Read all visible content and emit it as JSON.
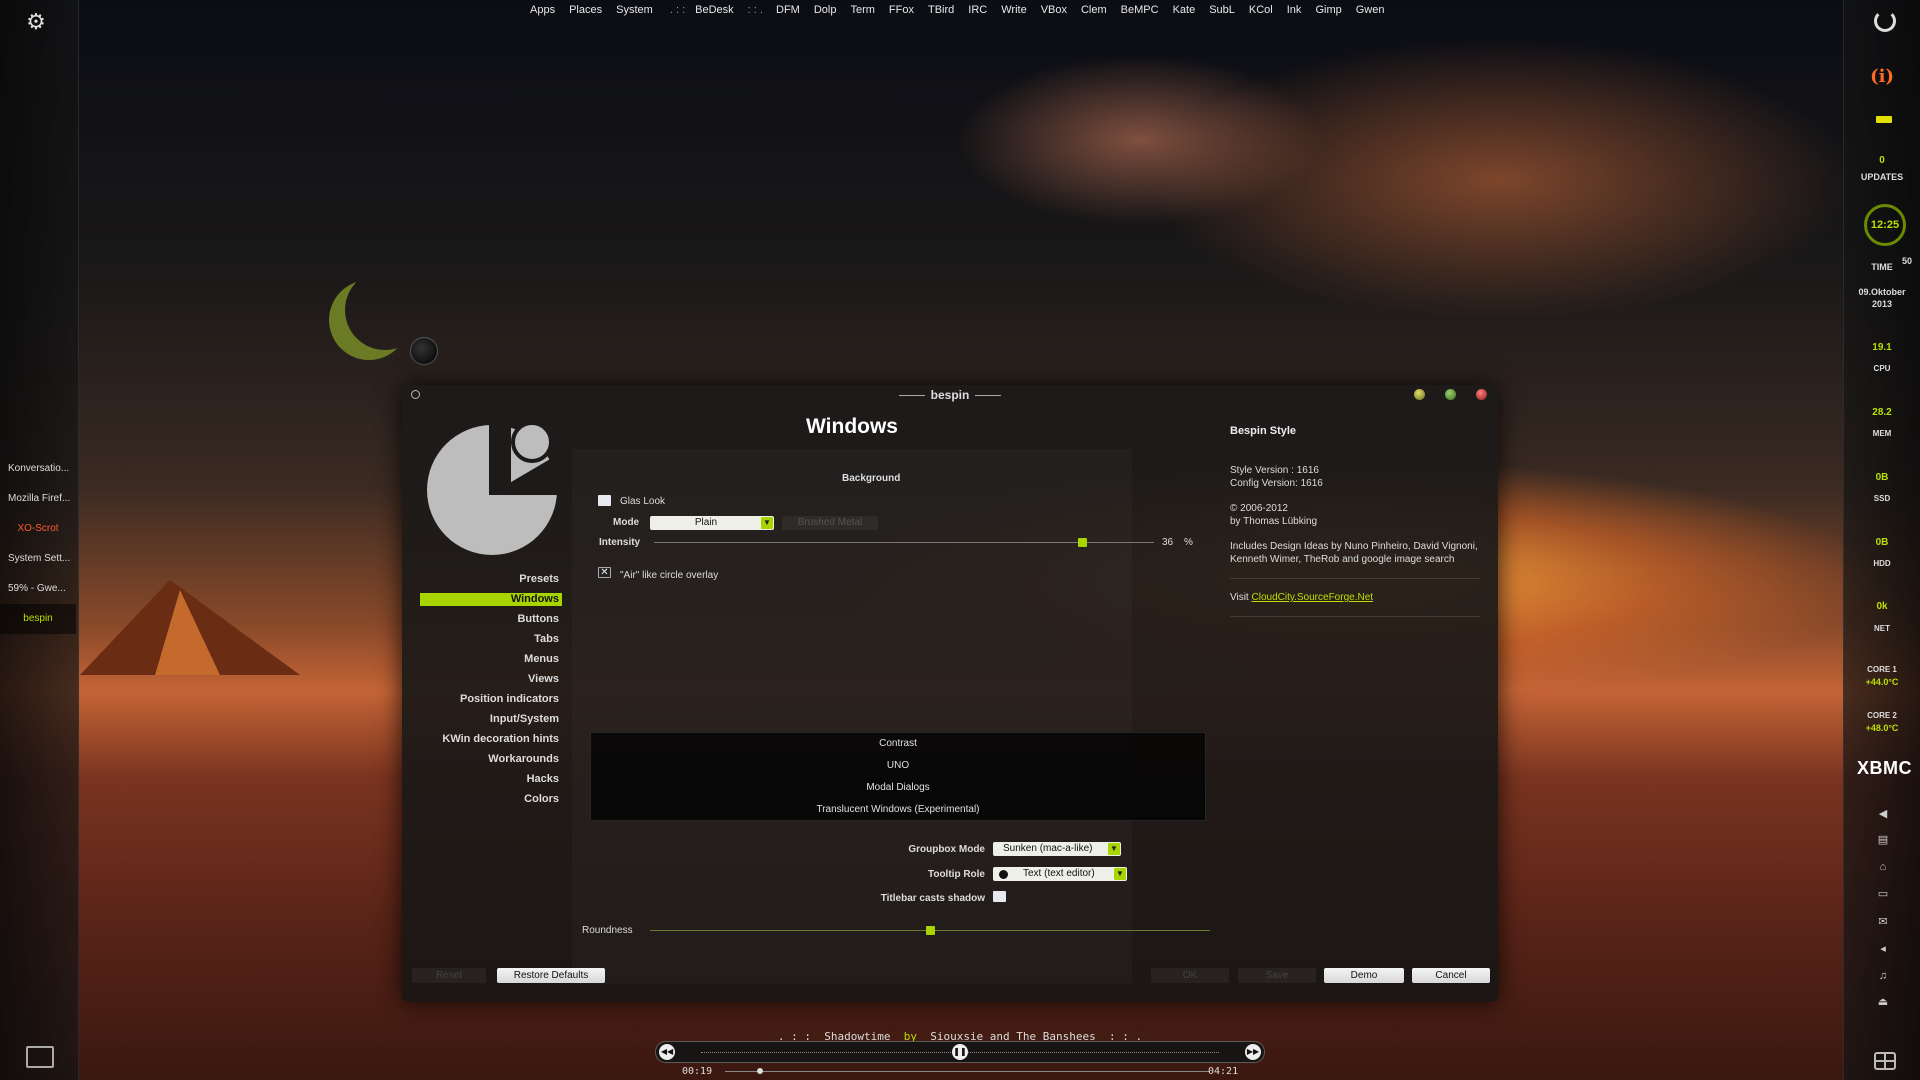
{
  "top_menu": {
    "items_left": [
      "Apps",
      "Places",
      "System"
    ],
    "sep1": ". : :",
    "bedesk": "BeDesk",
    "sep2": ": : .",
    "items_right": [
      "DFM",
      "Dolp",
      "Term",
      "FFox",
      "TBird",
      "IRC",
      "Write",
      "VBox",
      "Clem",
      "BeMPC",
      "Kate",
      "SubL",
      "KCol",
      "Ink",
      "Gimp",
      "Gwen"
    ]
  },
  "left_panel": {
    "tasks": [
      {
        "label": "Konversatio...",
        "state": "normal"
      },
      {
        "label": "Mozilla Firef...",
        "state": "normal"
      },
      {
        "label": "XO-Scrot",
        "state": "red"
      },
      {
        "label": "System Sett...",
        "state": "normal"
      },
      {
        "label": "59% - Gwe...",
        "state": "normal"
      },
      {
        "label": "bespin",
        "state": "active"
      }
    ]
  },
  "right_panel": {
    "updates_count": "0",
    "updates_label": "UPDATES",
    "clock_time": "12:25",
    "seconds": "50",
    "time_label": "TIME",
    "date_line1": "09.Oktober",
    "date_line2": "2013",
    "cpu_value": "19.1",
    "cpu_label": "CPU",
    "mem_value": "28.2",
    "mem_label": "MEM",
    "ssd_value": "0B",
    "ssd_label": "SSD",
    "hdd_value": "0B",
    "hdd_label": "HDD",
    "net_value": "0k",
    "net_label": "NET",
    "core1_label": "CORE 1",
    "core1_value": "+44.0°C",
    "core2_label": "CORE 2",
    "core2_value": "+48.0°C",
    "xbmc": "XBMC"
  },
  "dialog": {
    "title": "bespin",
    "page_title": "Windows",
    "nav": [
      "Presets",
      "Windows",
      "Buttons",
      "Tabs",
      "Menus",
      "Views",
      "Position indicators",
      "Input/System",
      "KWin decoration hints",
      "Workarounds",
      "Hacks",
      "Colors"
    ],
    "active_nav": "Windows",
    "background_label": "Background",
    "glas_look_label": "Glas Look",
    "glas_look_checked": false,
    "mode_label": "Mode",
    "mode_value": "Plain",
    "mode_disabled_value": "Brushed Metal",
    "intensity_label": "Intensity",
    "intensity_value": "36",
    "intensity_unit": "%",
    "air_label": "\"Air\" like circle overlay",
    "air_checked": true,
    "list_items": [
      "Contrast",
      "UNO",
      "Modal Dialogs",
      "Translucent Windows (Experimental)"
    ],
    "groupbox_label": "Groupbox Mode",
    "groupbox_value": "Sunken (mac-a-like)",
    "tooltip_label": "Tooltip Role",
    "tooltip_value": "Text (text editor)",
    "titlebar_shadow_label": "Titlebar casts shadow",
    "titlebar_shadow_checked": false,
    "roundness_label": "Roundness",
    "roundness_value": 0.5,
    "info": {
      "title": "Bespin Style",
      "style_version": "Style Version : 1616",
      "config_version": "Config Version: 1616",
      "copyright": "© 2006-2012",
      "author": "by Thomas Lübking",
      "includes": "Includes Design Ideas by Nuno Pinheiro, David Vignoni, Kenneth Wimer, TheRob and google image search",
      "visit_label": "Visit",
      "visit_link": "CloudCity.SourceForge.Net"
    },
    "buttons": {
      "reset": "Reset",
      "restore_defaults": "Restore Defaults",
      "ok": "OK",
      "save": "Save",
      "demo": "Demo",
      "cancel": "Cancel"
    }
  },
  "media": {
    "sep_left": ". : :",
    "track": "Shadowtime",
    "by": "by",
    "artist": "Siouxsie and The Banshees",
    "sep_right": ": : .",
    "elapsed": "00:19",
    "total": "04:21",
    "progress": 0.073
  },
  "colors": {
    "accent": "#a8d400",
    "accent_text": "#b9e000",
    "alert": "#ff5a32"
  }
}
